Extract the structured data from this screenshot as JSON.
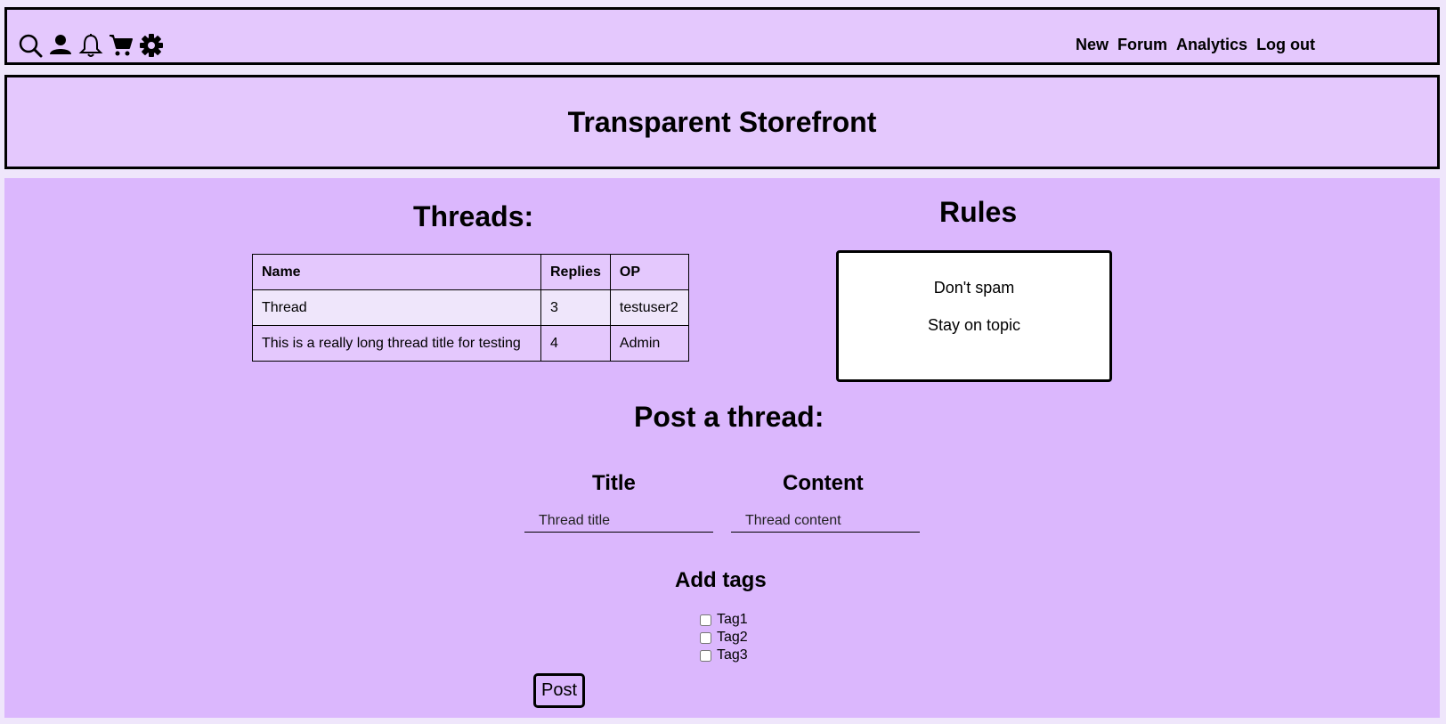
{
  "icons": [
    "search-icon",
    "user-icon",
    "bell-icon",
    "cart-icon",
    "gear-icon"
  ],
  "nav": {
    "new": "New",
    "forum": "Forum",
    "analytics": "Analytics",
    "logout": "Log out"
  },
  "banner": {
    "title": "Transparent Storefront"
  },
  "threads": {
    "heading": "Threads:",
    "columns": [
      "Name",
      "Replies",
      "OP"
    ],
    "rows": [
      {
        "name": "Thread",
        "replies": "3",
        "op": "testuser2"
      },
      {
        "name": "This is a really long thread title for testing",
        "replies": "4",
        "op": "Admin"
      }
    ]
  },
  "rules": {
    "heading": "Rules",
    "items": [
      "Don't spam",
      "Stay on topic"
    ]
  },
  "post": {
    "heading": "Post a thread:",
    "title_label": "Title",
    "content_label": "Content",
    "title_placeholder": "Thread title",
    "content_placeholder": "Thread content",
    "tags_label": "Add tags",
    "tags": [
      "Tag1",
      "Tag2",
      "Tag3"
    ],
    "submit_label": "Post"
  },
  "colors": {
    "header": "#e4c8fd",
    "main": "#dbb7fd",
    "page": "#efe6fb"
  }
}
